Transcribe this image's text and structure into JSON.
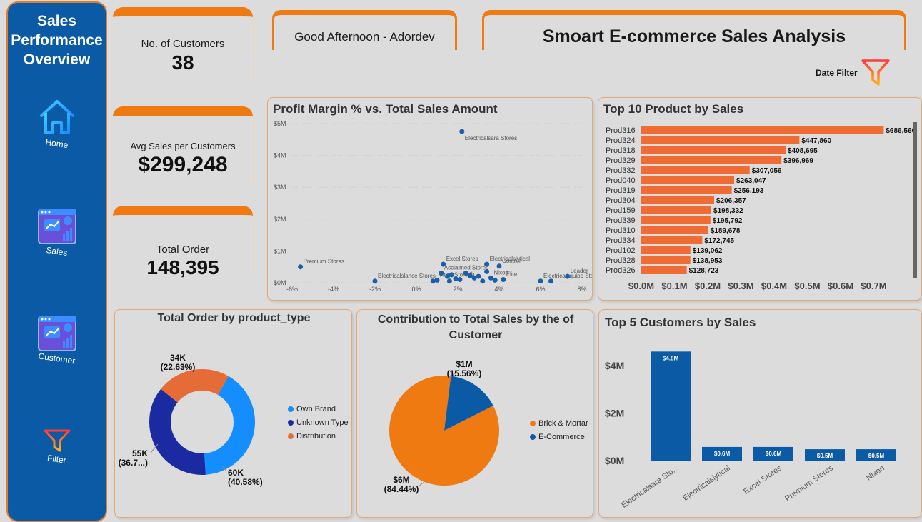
{
  "sidebar": {
    "title_line1": "Sales",
    "title_line2": "Performance",
    "title_line3": "Overview",
    "nav": [
      {
        "label": "Home",
        "icon": "home-icon"
      },
      {
        "label": "Sales",
        "icon": "sales-dashboard-icon"
      },
      {
        "label": "Customer",
        "icon": "customer-dashboard-icon"
      },
      {
        "label": "Filter",
        "icon": "filter-icon"
      }
    ]
  },
  "kpis": {
    "customers": {
      "label": "No. of Customers",
      "value": "38"
    },
    "avg_sales": {
      "label": "Avg Sales per Customers",
      "value": "$299,248"
    },
    "orders": {
      "label": "Total Order",
      "value": "148,395"
    }
  },
  "header": {
    "greeting": "Good Afternoon - Adordev",
    "title": "Smoart E-commerce Sales Analysis",
    "date_filter": "Date Filter"
  },
  "colors": {
    "accent_orange": "#f07a12",
    "primary_blue": "#0a5aa6",
    "bar_orange": "#ef6c35",
    "scatter_blue": "#1a5fa8",
    "donut_own_brand": "#148eff",
    "donut_unknown": "#1a2aa0",
    "donut_distribution": "#e66c37"
  },
  "chart_data": [
    {
      "type": "scatter",
      "title": "Profit Margin % vs. Total Sales Amount",
      "x_ticks": [
        "-6%",
        "-4%",
        "-2%",
        "0%",
        "2%",
        "4%",
        "6%",
        "8%"
      ],
      "y_ticks": [
        "$0M",
        "$1M",
        "$2M",
        "$3M",
        "$4M",
        "$5M"
      ],
      "xlim": [
        -6,
        8
      ],
      "ylim": [
        0,
        5
      ],
      "points": [
        {
          "label": "Electricalsara Stores",
          "x": 2.2,
          "y": 4.75
        },
        {
          "label": "Premium Stores",
          "x": -5.6,
          "y": 0.5
        },
        {
          "label": "Electricalslance Stores",
          "x": -2.0,
          "y": 0.05
        },
        {
          "label": "Excel Stores",
          "x": 1.3,
          "y": 0.58
        },
        {
          "label": "Electricalslytical",
          "x": 3.4,
          "y": 0.58
        },
        {
          "label": "Control",
          "x": 4.0,
          "y": 0.52
        },
        {
          "label": "Acclaimed Stores",
          "x": 1.2,
          "y": 0.3
        },
        {
          "label": "Atlas Stores",
          "x": 1.0,
          "y": 0.08
        },
        {
          "label": "",
          "x": 1.5,
          "y": 0.2
        },
        {
          "label": "",
          "x": 1.7,
          "y": 0.25
        },
        {
          "label": "",
          "x": 1.9,
          "y": 0.12
        },
        {
          "label": "Path",
          "x": 2.1,
          "y": 0.1
        },
        {
          "label": "",
          "x": 2.4,
          "y": 0.3
        },
        {
          "label": "",
          "x": 2.6,
          "y": 0.22
        },
        {
          "label": "",
          "x": 2.8,
          "y": 0.15
        },
        {
          "label": "Nixon",
          "x": 3.6,
          "y": 0.15
        },
        {
          "label": "",
          "x": 3.2,
          "y": 0.05
        },
        {
          "label": "",
          "x": 3.8,
          "y": 0.08
        },
        {
          "label": "Elite",
          "x": 4.2,
          "y": 0.1
        },
        {
          "label": "Electricalsquipo Stores",
          "x": 6.0,
          "y": 0.05
        },
        {
          "label": "",
          "x": 6.5,
          "y": 0.05
        },
        {
          "label": "Leader",
          "x": 7.3,
          "y": 0.2
        },
        {
          "label": "",
          "x": 0.8,
          "y": 0.05
        },
        {
          "label": "",
          "x": 1.6,
          "y": 0.05
        },
        {
          "label": "",
          "x": 3.0,
          "y": 0.2
        },
        {
          "label": "",
          "x": 3.4,
          "y": 0.35
        }
      ]
    },
    {
      "type": "bar",
      "orientation": "horizontal",
      "title": "Top 10 Product by Sales",
      "categories": [
        "Prod316",
        "Prod324",
        "Prod318",
        "Prod329",
        "Prod332",
        "Prod040",
        "Prod319",
        "Prod304",
        "Prod159",
        "Prod339",
        "Prod310",
        "Prod334",
        "Prod102",
        "Prod328",
        "Prod326"
      ],
      "values": [
        686566,
        447860,
        408695,
        396969,
        307056,
        263047,
        256193,
        206357,
        198332,
        195792,
        189678,
        172745,
        139062,
        138953,
        128723
      ],
      "value_labels": [
        "$686,566",
        "$447,860",
        "$408,695",
        "$396,969",
        "$307,056",
        "$263,047",
        "$256,193",
        "$206,357",
        "$198,332",
        "$195,792",
        "$189,678",
        "$172,745",
        "$139,062",
        "$138,953",
        "$128,723"
      ],
      "x_ticks": [
        "$0.0M",
        "$0.1M",
        "$0.2M",
        "$0.3M",
        "$0.4M",
        "$0.5M",
        "$0.6M",
        "$0.7M"
      ],
      "xlim": [
        0,
        700000
      ]
    },
    {
      "type": "pie",
      "variant": "donut",
      "title": "Total Order by product_type",
      "slices": [
        {
          "name": "Own Brand",
          "value": 40.58,
          "label_value": "60K",
          "label_pct": "(40.58%)"
        },
        {
          "name": "Unknown Type",
          "value": 36.79,
          "label_value": "55K",
          "label_pct": "(36.7...)"
        },
        {
          "name": "Distribution",
          "value": 22.63,
          "label_value": "34K",
          "label_pct": "(22.63%)"
        }
      ]
    },
    {
      "type": "pie",
      "title_line1": "Contribution to Total Sales by the of",
      "title_line2": "Customer",
      "slices": [
        {
          "name": "Brick & Mortar",
          "value": 84.44,
          "label_value": "$6M",
          "label_pct": "(84.44%)",
          "color": "#f07a12"
        },
        {
          "name": "E-Commerce",
          "value": 15.56,
          "label_value": "$1M",
          "label_pct": "(15.56%)",
          "color": "#0a5aa6"
        }
      ]
    },
    {
      "type": "bar",
      "title": "Top 5 Customers by Sales",
      "categories": [
        "Electricalsara Sto...",
        "Electricalslytical",
        "Excel Stores",
        "Premium Stores",
        "Nixon"
      ],
      "values": [
        4.8,
        0.6,
        0.6,
        0.5,
        0.5
      ],
      "value_labels": [
        "$4.8M",
        "$0.6M",
        "$0.6M",
        "$0.5M",
        "$0.5M"
      ],
      "y_ticks": [
        "$0M",
        "$2M",
        "$4M"
      ],
      "ylim": [
        0,
        5
      ]
    }
  ]
}
